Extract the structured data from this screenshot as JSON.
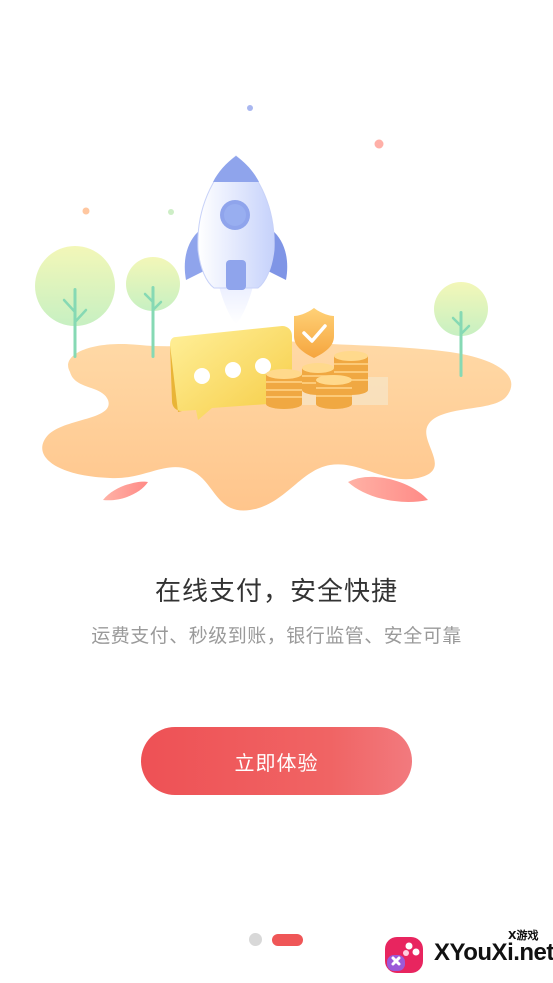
{
  "intro": {
    "headline": "在线支付，安全快捷",
    "subline": "运费支付、秒级到账，银行监管、安全可靠"
  },
  "cta": {
    "label": "立即体验"
  },
  "pager": {
    "total": 2,
    "current": 2
  },
  "watermark": {
    "small_text": "X游戏",
    "site_text": "XYouXi.net"
  },
  "colors": {
    "accent": "#ef5657",
    "island": "#ffd29a",
    "rocket": "#8fa4ec",
    "coin": "#f5b74f"
  }
}
